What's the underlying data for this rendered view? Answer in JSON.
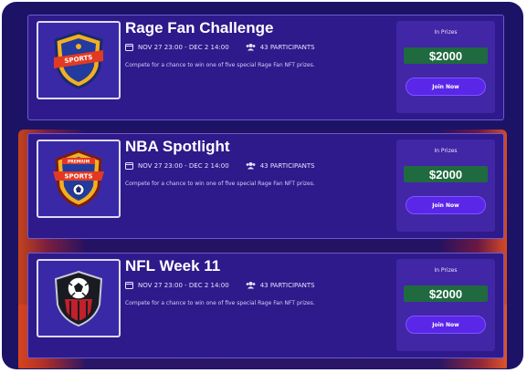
{
  "challenges": [
    {
      "title": "Rage Fan Challenge",
      "dates": "NOV 27 23:00 - DEC 2 14:00",
      "participants": "43 PARTICIPANTS",
      "description": "Compete for a chance to win one of five special Rage Fan NFT prizes.",
      "prize_label": "In Prizes",
      "prize_value": "$2000",
      "join_label": "Join Now",
      "badge_icon": "sports-shield-badge-icon"
    },
    {
      "title": "NBA Spotlight",
      "dates": "NOV 27 23:00 - DEC 2 14:00",
      "participants": "43 PARTICIPANTS",
      "description": "Compete for a chance to win one of five special Rage Fan NFT prizes.",
      "prize_label": "In Prizes",
      "prize_value": "$2000",
      "join_label": "Join Now",
      "badge_icon": "premium-sports-badge-icon"
    },
    {
      "title": "NFL Week 11",
      "dates": "NOV 27 23:00 - DEC 2 14:00",
      "participants": "43 PARTICIPANTS",
      "description": "Compete for a chance to win one of five special Rage Fan NFT prizes.",
      "prize_label": "In Prizes",
      "prize_value": "$2000",
      "join_label": "Join Now",
      "badge_icon": "soccer-ball-shield-icon"
    }
  ],
  "colors": {
    "background": "#1c1366",
    "card": "#2e1a8a",
    "prize_panel": "#4126a6",
    "prize_value_bg": "#1f6a3f",
    "join_button": "#5a26e8"
  }
}
